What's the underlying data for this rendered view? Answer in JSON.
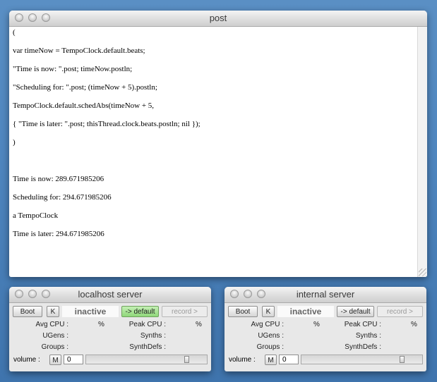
{
  "post": {
    "title": "post",
    "lines": [
      "(",
      "var timeNow = TempoClock.default.beats;",
      "\"Time is now: \".post; timeNow.postln;",
      "\"Scheduling for: \".post; (timeNow + 5).postln;",
      "TempoClock.default.schedAbs(timeNow + 5,",
      "{ \"Time is later: \".post; thisThread.clock.beats.postln; nil });",
      ")",
      "",
      "Time is now: 289.671985206",
      "Scheduling for: 294.671985206",
      "a TempoClock",
      "Time is later: 294.671985206"
    ]
  },
  "servers": [
    {
      "title": "localhost server",
      "boot_label": "Boot",
      "k_label": "K",
      "status": "inactive",
      "default_label": "-> default",
      "default_active": true,
      "record_label": "record >",
      "avg_cpu_label": "Avg CPU :",
      "avg_cpu_unit": "%",
      "peak_cpu_label": "Peak CPU :",
      "peak_cpu_unit": "%",
      "ugens_label": "UGens :",
      "synths_label": "Synths :",
      "groups_label": "Groups :",
      "synthdefs_label": "SynthDefs :",
      "volume_label": "volume :",
      "mute_label": "M",
      "volume_value": "0",
      "volume_level": 0.85
    },
    {
      "title": "internal server",
      "boot_label": "Boot",
      "k_label": "K",
      "status": "inactive",
      "default_label": "-> default",
      "default_active": false,
      "record_label": "record >",
      "avg_cpu_label": "Avg CPU :",
      "avg_cpu_unit": "%",
      "peak_cpu_label": "Peak CPU :",
      "peak_cpu_unit": "%",
      "ugens_label": "UGens :",
      "synths_label": "Synths :",
      "groups_label": "Groups :",
      "synthdefs_label": "SynthDefs :",
      "volume_label": "volume :",
      "mute_label": "M",
      "volume_value": "0",
      "volume_level": 0.85
    }
  ]
}
